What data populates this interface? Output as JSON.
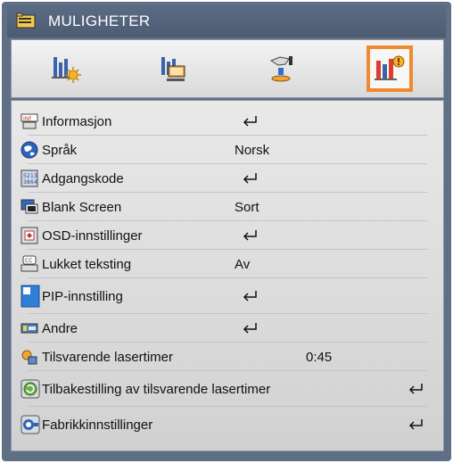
{
  "title": "MULIGHETER",
  "tabs": [
    {
      "icon": "bar-chart-sun-icon"
    },
    {
      "icon": "display-screen-icon"
    },
    {
      "icon": "hand-setup-icon"
    },
    {
      "icon": "options-chart-icon",
      "selected": true
    }
  ],
  "items": [
    {
      "label": "Informasjon",
      "value": "",
      "enter": true
    },
    {
      "label": "Språk",
      "value": "Norsk",
      "enter": false
    },
    {
      "label": "Adgangskode",
      "value": "",
      "enter": true
    },
    {
      "label": "Blank Screen",
      "value": "Sort",
      "enter": false
    },
    {
      "label": "OSD-innstillinger",
      "value": "",
      "enter": true
    },
    {
      "label": "Lukket teksting",
      "value": "Av",
      "enter": false
    },
    {
      "label": "PIP-innstilling",
      "value": "",
      "enter": true
    },
    {
      "label": "Andre",
      "value": "",
      "enter": true
    },
    {
      "label": "Tilsvarende lasertimer",
      "value": "0:45",
      "enter": false
    },
    {
      "label": "Tilbakestilling av tilsvarende lasertimer",
      "value": "",
      "enter": true
    },
    {
      "label": "Fabrikkinnstillinger",
      "value": "",
      "enter": true
    }
  ],
  "colors": {
    "accent": "#ef8b2e",
    "frame": "#5f6f86",
    "panel": "#e2e2e2"
  }
}
